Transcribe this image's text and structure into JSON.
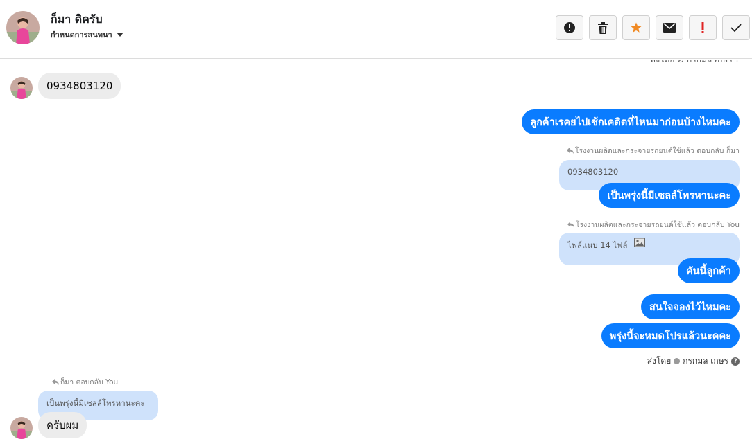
{
  "header": {
    "contact_name": "ก็มา ดิครับ",
    "assign_label": "กำหนดการสนทนา",
    "actions": [
      {
        "name": "alert-button",
        "icon": "alert-circle-icon"
      },
      {
        "name": "delete-button",
        "icon": "trash-icon"
      },
      {
        "name": "star-button",
        "icon": "star-icon"
      },
      {
        "name": "mark-unread-button",
        "icon": "envelope-icon"
      },
      {
        "name": "priority-button",
        "icon": "exclamation-icon"
      },
      {
        "name": "done-button",
        "icon": "checkmark-icon"
      }
    ]
  },
  "colors": {
    "outgoing_bubble": "#0a7cff",
    "incoming_bubble": "#ececec",
    "quote_bubble": "#cfe2fb",
    "star": "#f08a24",
    "priority": "#e02424"
  },
  "messages": {
    "top_cut_text": "ส่งโดย ⊘ กรกมล เกษร ?",
    "m1_phone": "0934803120",
    "m2_out": "ลูกค้าเรคยไปเช้กเคดิตที่ไหนมาก่อนบ้างไหมคะ",
    "m3_meta": "โรงงานผลิตและกระจายรถยนต์ใช้แล้ว ตอบกลับ ก็มา",
    "m3_quote": "0934803120",
    "m3_out": "เป็นพรุ่งนี้มีเซลล์โทรหานะคะ",
    "m4_meta": "โรงงานผลิตและกระจายรถยนต์ใช้แล้ว ตอบกลับ You",
    "m4_quote": "ไฟล์แนบ 14 ไฟล์",
    "m4_out": "คันนี้ลูกค้า",
    "m5_out": "สนใจจองไว้ไหมคะ",
    "m6_out": "พรุ่งนี้จะหมดโปรแล้วนะคคะ",
    "sent_by_label": "ส่งโดย",
    "sent_by_name": "กรกมล เกษร",
    "m7_meta": "ก็มา ตอบกลับ You",
    "m7_quote": "เป็นพรุ่งนี้มีเซลล์โทรหานะคะ",
    "m7_in": "ครับผม"
  }
}
